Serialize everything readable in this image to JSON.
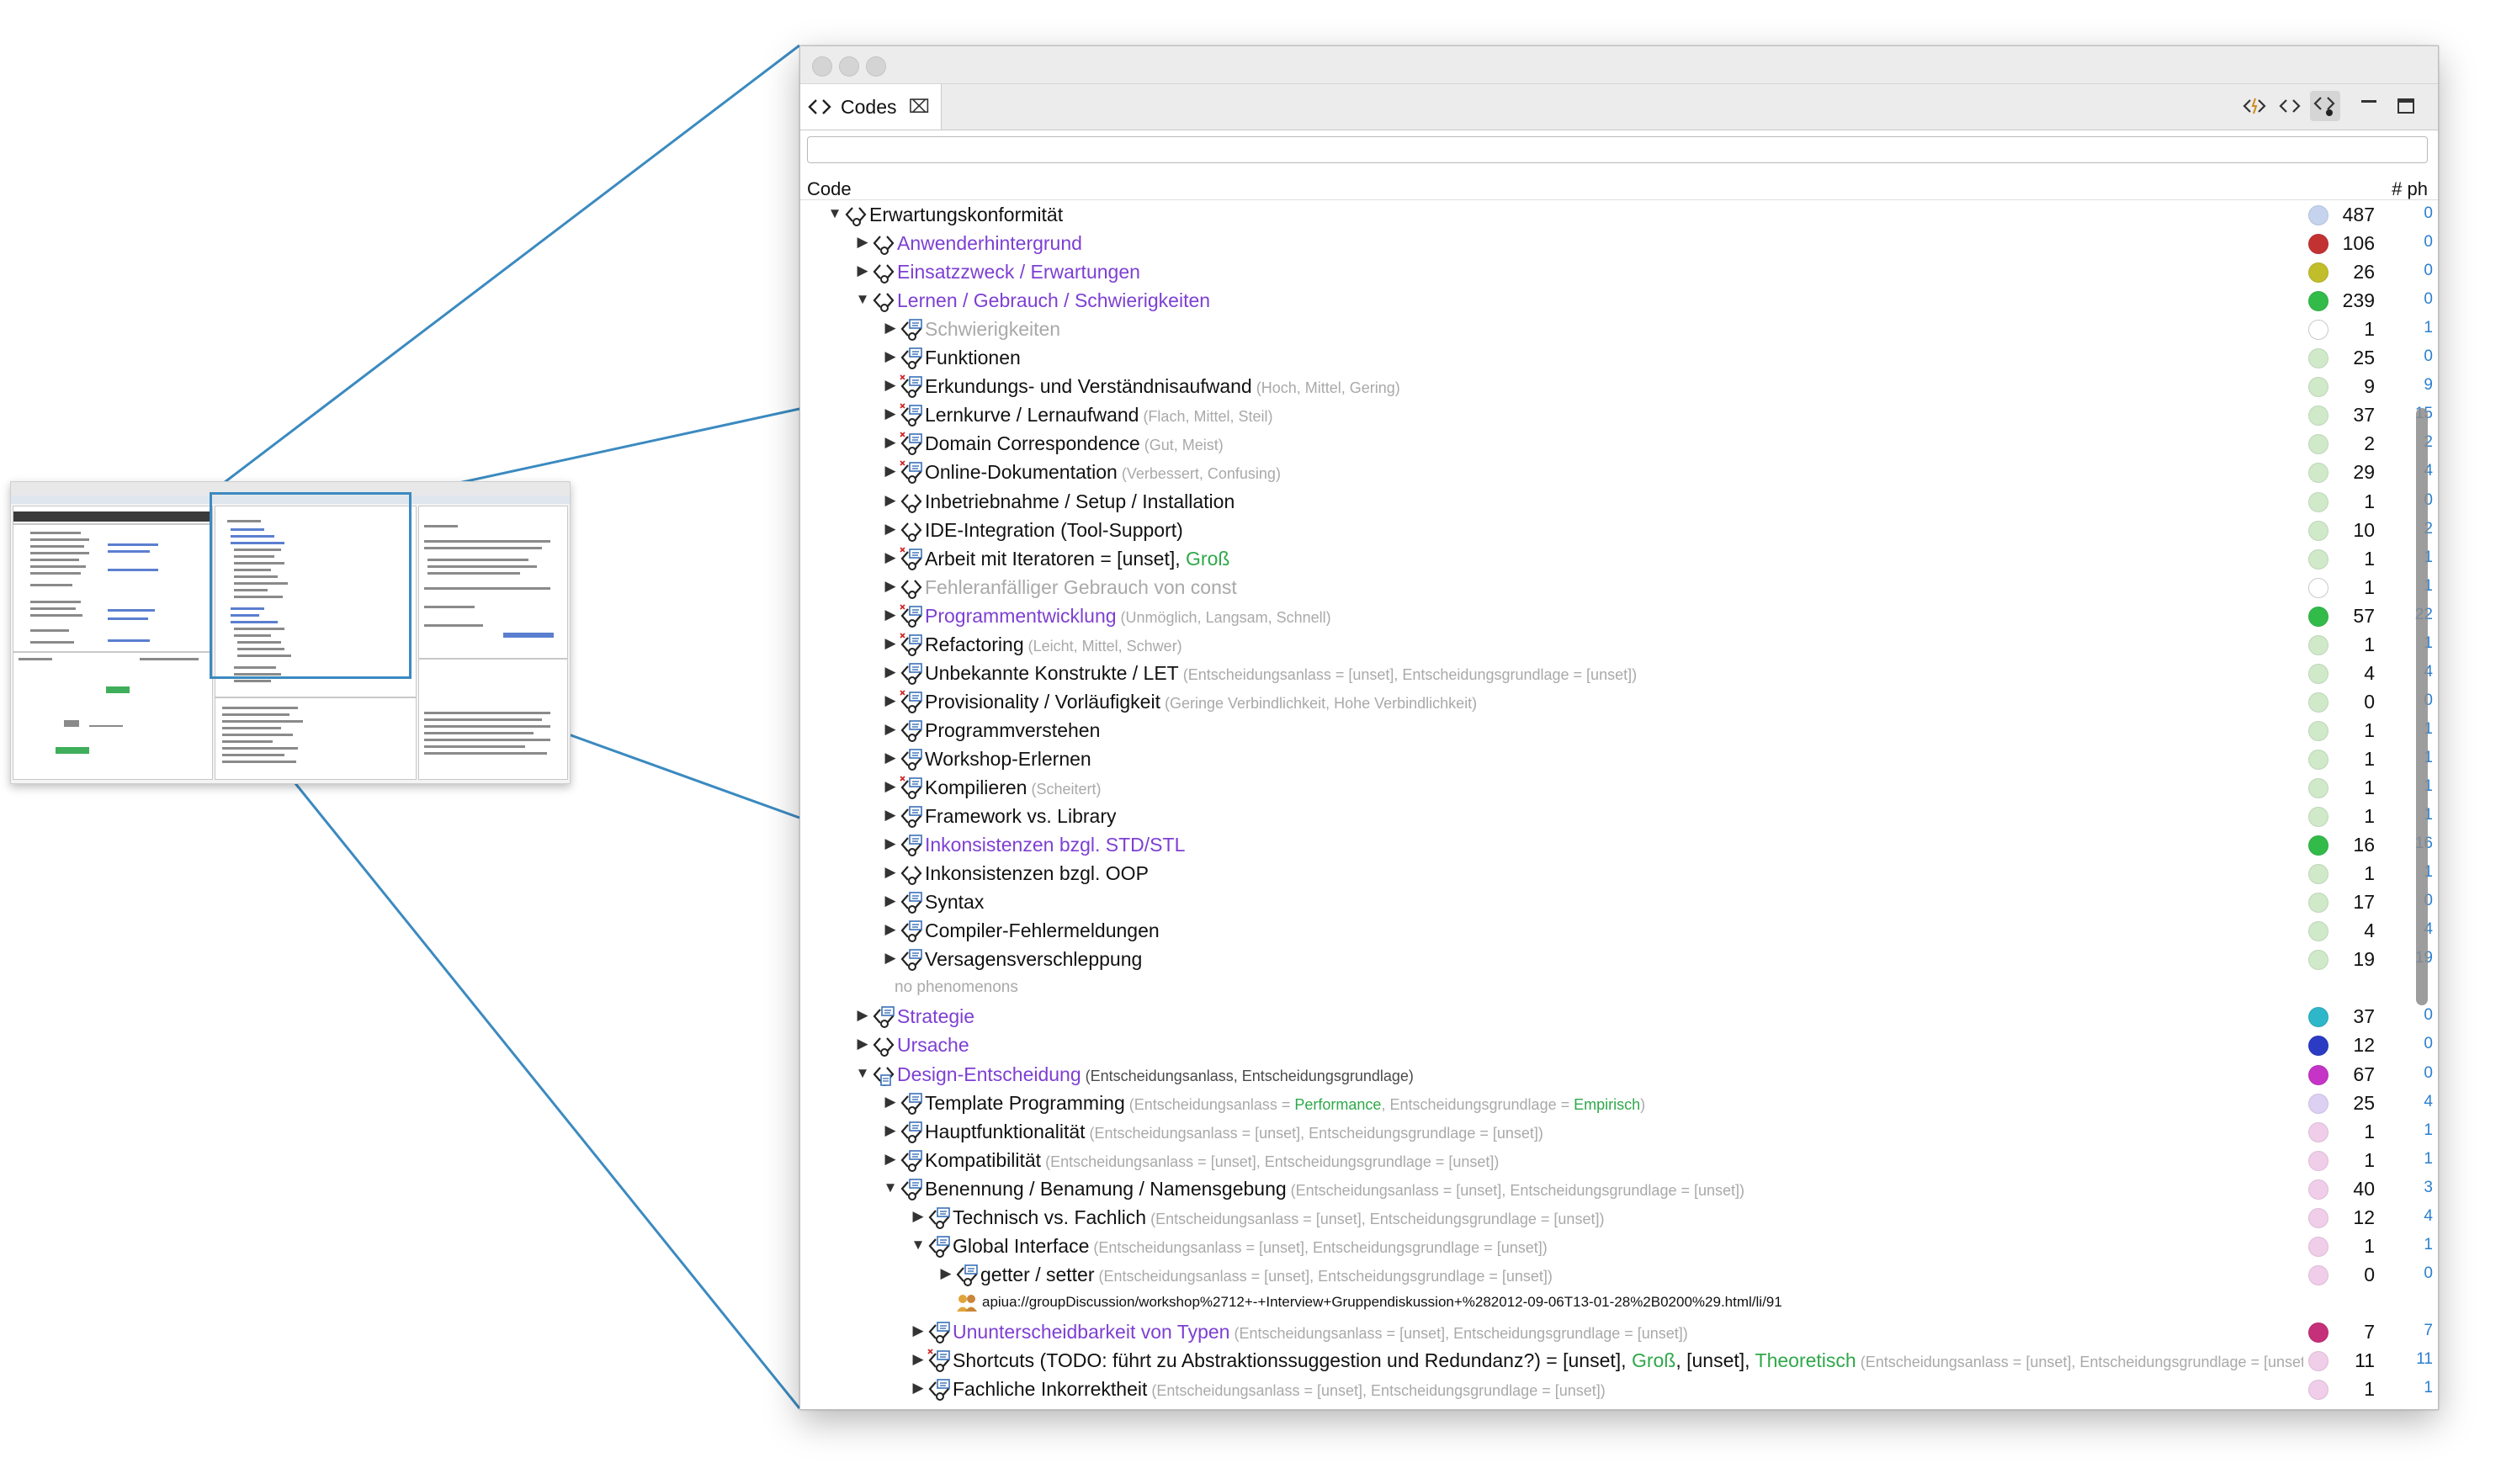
{
  "window": {
    "tab_label": "Codes",
    "filter_value": "",
    "column_code": "Code",
    "column_count": "# ph",
    "toolbar_icons": [
      "linked-code-icon",
      "code-icon",
      "show-code-instances-icon",
      "minimize-icon",
      "maximize-icon"
    ]
  },
  "rows": [
    {
      "depth": 0,
      "tw": "open",
      "icon": "code",
      "name": "Erwartungskonformität",
      "style": "dark",
      "traits": [],
      "dot": "#c5d3ee",
      "c1": "487",
      "c2": "0"
    },
    {
      "depth": 1,
      "tw": "closed",
      "icon": "code",
      "name": "Anwenderhintergrund",
      "style": "purple",
      "traits": [],
      "dot": "#c33232",
      "c1": "106",
      "c2": "0"
    },
    {
      "depth": 1,
      "tw": "closed",
      "icon": "code",
      "name": "Einsatzzweck / Erwartungen",
      "style": "purple",
      "traits": [],
      "dot": "#c2bd2b",
      "c1": "26",
      "c2": "0"
    },
    {
      "depth": 1,
      "tw": "open",
      "icon": "code",
      "name": "Lernen / Gebrauch / Schwierigkeiten",
      "style": "purple",
      "traits": [],
      "dot": "#33bb4a",
      "c1": "239",
      "c2": "0"
    },
    {
      "depth": 2,
      "tw": "closed",
      "icon": "code-ph",
      "name": "Schwierigkeiten",
      "style": "gray",
      "traits": [],
      "dot": "#ffffff",
      "c1": "1",
      "c2": "1"
    },
    {
      "depth": 2,
      "tw": "closed",
      "icon": "code-ph",
      "name": "Funktionen",
      "style": "dark",
      "traits": [],
      "dot": "#cfe9c9",
      "c1": "25",
      "c2": "0"
    },
    {
      "depth": 2,
      "tw": "closed",
      "icon": "code-ph-x",
      "name": "Erkundungs- und Verständnisaufwand",
      "style": "dark",
      "traits": [
        {
          "t": " (Hoch, Mittel, Gering)",
          "s": "light"
        }
      ],
      "dot": "#cfe9c9",
      "c1": "9",
      "c2": "9"
    },
    {
      "depth": 2,
      "tw": "closed",
      "icon": "code-ph-x",
      "name": "Lernkurve / Lernaufwand",
      "style": "dark",
      "traits": [
        {
          "t": " (Flach, Mittel, Steil)",
          "s": "light"
        }
      ],
      "dot": "#cfe9c9",
      "c1": "37",
      "c2": "15"
    },
    {
      "depth": 2,
      "tw": "closed",
      "icon": "code-ph-x",
      "name": "Domain Correspondence",
      "style": "dark",
      "traits": [
        {
          "t": " (Gut, Meist)",
          "s": "light"
        }
      ],
      "dot": "#cfe9c9",
      "c1": "2",
      "c2": "2"
    },
    {
      "depth": 2,
      "tw": "closed",
      "icon": "code-ph-x",
      "name": "Online-Dokumentation",
      "style": "dark",
      "traits": [
        {
          "t": " (Verbessert, Confusing)",
          "s": "light"
        }
      ],
      "dot": "#cfe9c9",
      "c1": "29",
      "c2": "4"
    },
    {
      "depth": 2,
      "tw": "closed",
      "icon": "code",
      "name": "Inbetriebnahme / Setup / Installation",
      "style": "dark",
      "traits": [],
      "dot": "#cfe9c9",
      "c1": "1",
      "c2": "0"
    },
    {
      "depth": 2,
      "tw": "closed",
      "icon": "code",
      "name": "IDE-Integration (Tool-Support)",
      "style": "dark",
      "traits": [],
      "dot": "#cfe9c9",
      "c1": "10",
      "c2": "2"
    },
    {
      "depth": 2,
      "tw": "closed",
      "icon": "code-ph-x",
      "name": "Arbeit mit Iteratoren = [unset], ",
      "style": "dark",
      "traits": [
        {
          "t": "Groß",
          "s": "green2"
        }
      ],
      "dot": "#cfe9c9",
      "c1": "1",
      "c2": "1"
    },
    {
      "depth": 2,
      "tw": "closed",
      "icon": "code",
      "name": "Fehleranfälliger Gebrauch von const",
      "style": "gray",
      "traits": [],
      "dot": "#ffffff",
      "c1": "1",
      "c2": "1"
    },
    {
      "depth": 2,
      "tw": "closed",
      "icon": "code-ph-x",
      "name": "Programmentwicklung",
      "style": "purple",
      "traits": [
        {
          "t": " (Unmöglich, Langsam, Schnell)",
          "s": "light"
        }
      ],
      "dot": "#33bb4a",
      "c1": "57",
      "c2": "22"
    },
    {
      "depth": 2,
      "tw": "closed",
      "icon": "code-ph-x",
      "name": "Refactoring",
      "style": "dark",
      "traits": [
        {
          "t": " (Leicht, Mittel, Schwer)",
          "s": "light"
        }
      ],
      "dot": "#cfe9c9",
      "c1": "1",
      "c2": "1"
    },
    {
      "depth": 2,
      "tw": "closed",
      "icon": "code-ph",
      "name": "Unbekannte Konstrukte / LET",
      "style": "dark",
      "traits": [
        {
          "t": " (Entscheidungsanlass = [unset], Entscheidungsgrundlage = [unset])",
          "s": "light"
        }
      ],
      "dot": "#cfe9c9",
      "c1": "4",
      "c2": "4"
    },
    {
      "depth": 2,
      "tw": "closed",
      "icon": "code-ph-x",
      "name": "Provisionality / Vorläufigkeit",
      "style": "dark",
      "traits": [
        {
          "t": " (Geringe Verbindlichkeit, Hohe Verbindlichkeit)",
          "s": "light"
        }
      ],
      "dot": "#cfe9c9",
      "c1": "0",
      "c2": "0"
    },
    {
      "depth": 2,
      "tw": "closed",
      "icon": "code-ph",
      "name": "Programmverstehen",
      "style": "dark",
      "traits": [],
      "dot": "#cfe9c9",
      "c1": "1",
      "c2": "1"
    },
    {
      "depth": 2,
      "tw": "closed",
      "icon": "code-ph",
      "name": "Workshop-Erlernen",
      "style": "dark",
      "traits": [],
      "dot": "#cfe9c9",
      "c1": "1",
      "c2": "1"
    },
    {
      "depth": 2,
      "tw": "closed",
      "icon": "code-ph-x",
      "name": "Kompilieren",
      "style": "dark",
      "traits": [
        {
          "t": " (Scheitert)",
          "s": "light"
        }
      ],
      "dot": "#cfe9c9",
      "c1": "1",
      "c2": "1"
    },
    {
      "depth": 2,
      "tw": "closed",
      "icon": "code-ph",
      "name": "Framework vs. Library",
      "style": "dark",
      "traits": [],
      "dot": "#cfe9c9",
      "c1": "1",
      "c2": "1"
    },
    {
      "depth": 2,
      "tw": "closed",
      "icon": "code-ph",
      "name": "Inkonsistenzen bzgl. STD/STL",
      "style": "purple",
      "traits": [],
      "dot": "#33bb4a",
      "c1": "16",
      "c2": "16"
    },
    {
      "depth": 2,
      "tw": "closed",
      "icon": "code",
      "name": "Inkonsistenzen bzgl. OOP",
      "style": "dark",
      "traits": [],
      "dot": "#cfe9c9",
      "c1": "1",
      "c2": "1"
    },
    {
      "depth": 2,
      "tw": "closed",
      "icon": "code-ph",
      "name": "Syntax",
      "style": "dark",
      "traits": [],
      "dot": "#cfe9c9",
      "c1": "17",
      "c2": "0"
    },
    {
      "depth": 2,
      "tw": "closed",
      "icon": "code-ph",
      "name": "Compiler-Fehlermeldungen",
      "style": "dark",
      "traits": [],
      "dot": "#cfe9c9",
      "c1": "4",
      "c2": "4"
    },
    {
      "depth": 2,
      "tw": "closed",
      "icon": "code-ph",
      "name": "Versagensverschleppung",
      "style": "dark",
      "traits": [],
      "dot": "#cfe9c9",
      "c1": "19",
      "c2": "19"
    },
    {
      "depth": 2,
      "tw": "none",
      "icon": "none",
      "name": "no phenomenons",
      "style": "note",
      "traits": [],
      "dot": "",
      "c1": "",
      "c2": ""
    },
    {
      "depth": 1,
      "tw": "closed",
      "icon": "code-ph",
      "name": "Strategie",
      "style": "purple",
      "traits": [],
      "dot": "#2eb6c9",
      "c1": "37",
      "c2": "0"
    },
    {
      "depth": 1,
      "tw": "closed",
      "icon": "code",
      "name": "Ursache",
      "style": "purple",
      "traits": [],
      "dot": "#2b3bc4",
      "c1": "12",
      "c2": "0"
    },
    {
      "depth": 1,
      "tw": "open",
      "icon": "code-doc",
      "name": "Design-Entscheidung",
      "style": "purple",
      "traits": [
        {
          "t": " (Entscheidungsanlass, Entscheidungsgrundlage)",
          "s": "dark"
        }
      ],
      "dot": "#c534c7",
      "c1": "67",
      "c2": "0"
    },
    {
      "depth": 2,
      "tw": "closed",
      "icon": "code-ph",
      "name": "Template Programming",
      "style": "dark",
      "traits": [
        {
          "t": " (Entscheidungsanlass = ",
          "s": "light"
        },
        {
          "t": "Performance",
          "s": "green"
        },
        {
          "t": ", Entscheidungsgrundlage = ",
          "s": "light"
        },
        {
          "t": "Empirisch",
          "s": "green"
        },
        {
          "t": ")",
          "s": "light"
        }
      ],
      "dot": "#ddd0f2",
      "c1": "25",
      "c2": "4"
    },
    {
      "depth": 2,
      "tw": "closed",
      "icon": "code-ph",
      "name": "Hauptfunktionalität",
      "style": "dark",
      "traits": [
        {
          "t": " (Entscheidungsanlass = [unset], Entscheidungsgrundlage = [unset])",
          "s": "light"
        }
      ],
      "dot": "#f0cde9",
      "c1": "1",
      "c2": "1"
    },
    {
      "depth": 2,
      "tw": "closed",
      "icon": "code-ph",
      "name": "Kompatibilität",
      "style": "dark",
      "traits": [
        {
          "t": " (Entscheidungsanlass = [unset], Entscheidungsgrundlage = [unset])",
          "s": "light"
        }
      ],
      "dot": "#f0cde9",
      "c1": "1",
      "c2": "1"
    },
    {
      "depth": 2,
      "tw": "open",
      "icon": "code-ph",
      "name": "Benennung / Benamung / Namensgebung",
      "style": "dark",
      "traits": [
        {
          "t": " (Entscheidungsanlass = [unset], Entscheidungsgrundlage = [unset])",
          "s": "light"
        }
      ],
      "dot": "#f0cde9",
      "c1": "40",
      "c2": "3"
    },
    {
      "depth": 3,
      "tw": "closed",
      "icon": "code-ph",
      "name": "Technisch vs. Fachlich",
      "style": "dark",
      "traits": [
        {
          "t": " (Entscheidungsanlass = [unset], Entscheidungsgrundlage = [unset])",
          "s": "light"
        }
      ],
      "dot": "#f0cde9",
      "c1": "12",
      "c2": "4"
    },
    {
      "depth": 3,
      "tw": "open",
      "icon": "code-ph",
      "name": "Global Interface",
      "style": "dark",
      "traits": [
        {
          "t": " (Entscheidungsanlass = [unset], Entscheidungsgrundlage = [unset])",
          "s": "light"
        }
      ],
      "dot": "#f0cde9",
      "c1": "1",
      "c2": "1"
    },
    {
      "depth": 4,
      "tw": "closed",
      "icon": "code-ph",
      "name": "getter / setter",
      "style": "dark",
      "traits": [
        {
          "t": " (Entscheidungsanlass = [unset], Entscheidungsgrundlage = [unset])",
          "s": "light"
        }
      ],
      "dot": "#f0cde9",
      "c1": "0",
      "c2": "0"
    },
    {
      "depth": 4,
      "tw": "none",
      "icon": "people",
      "name": "apiua://groupDiscussion/workshop%2712+-+Interview+Gruppendiskussion+%282012-09-06T13-01-28%2B0200%29.html/li/91",
      "style": "link",
      "traits": [],
      "dot": "",
      "c1": "",
      "c2": ""
    },
    {
      "depth": 3,
      "tw": "closed",
      "icon": "code-ph",
      "name": "Ununterscheidbarkeit von Typen",
      "style": "purple",
      "traits": [
        {
          "t": " (Entscheidungsanlass = [unset], Entscheidungsgrundlage = [unset])",
          "s": "light"
        }
      ],
      "dot": "#c5307a",
      "c1": "7",
      "c2": "7"
    },
    {
      "depth": 3,
      "tw": "closed",
      "icon": "code-ph-x",
      "name": "Shortcuts (TODO: führt zu Abstraktionssuggestion und Redundanz?) = [unset], ",
      "style": "dark",
      "traits": [
        {
          "t": "Groß",
          "s": "green2"
        },
        {
          "t": ", [unset], ",
          "s": "dark2"
        },
        {
          "t": "Theoretisch",
          "s": "green2"
        },
        {
          "t": " (Entscheidungsanlass = [unset], Entscheidungsgrundlage = [unset])",
          "s": "light"
        }
      ],
      "dot": "#f0cde9",
      "c1": "11",
      "c2": "11"
    },
    {
      "depth": 3,
      "tw": "closed",
      "icon": "code-ph",
      "name": "Fachliche Inkorrektheit",
      "style": "dark",
      "traits": [
        {
          "t": " (Entscheidungsanlass = [unset], Entscheidungsgrundlage = [unset])",
          "s": "light"
        }
      ],
      "dot": "#f0cde9",
      "c1": "1",
      "c2": "1"
    }
  ]
}
